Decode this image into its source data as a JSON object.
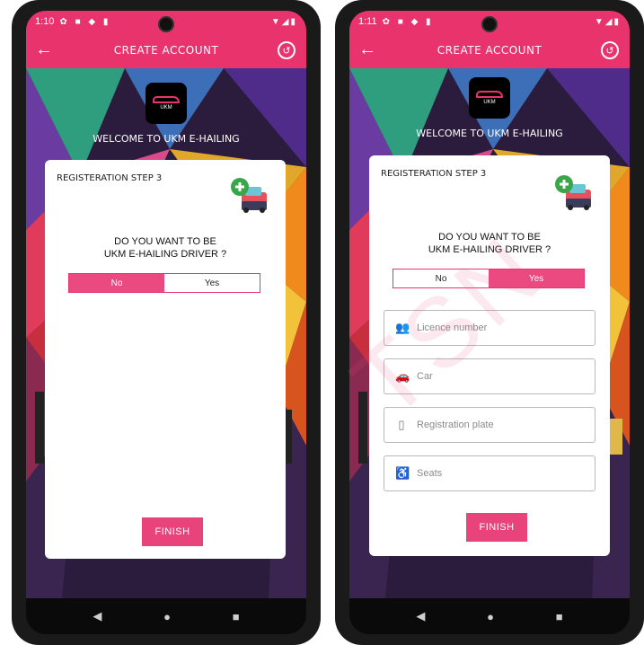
{
  "left": {
    "status_time": "1:10",
    "appbar_title": "CREATE ACCOUNT",
    "welcome": "WELCOME TO UKM E-HAILING",
    "logo_text": "UKM",
    "step_label": "REGISTERATION STEP 3",
    "question_line1": "DO YOU WANT TO BE",
    "question_line2": "UKM E-HAILING DRIVER ?",
    "toggle_no": "No",
    "toggle_yes": "Yes",
    "selected": "No",
    "finish_label": "FINISH"
  },
  "right": {
    "status_time": "1:11",
    "appbar_title": "CREATE ACCOUNT",
    "welcome": "WELCOME TO UKM E-HAILING",
    "logo_text": "UKM",
    "step_label": "REGISTERATION STEP 3",
    "question_line1": "DO YOU WANT TO BE",
    "question_line2": "UKM E-HAILING DRIVER ?",
    "toggle_no": "No",
    "toggle_yes": "Yes",
    "selected": "Yes",
    "fields": {
      "licence": "Licence number",
      "car": "Car",
      "plate": "Registration plate",
      "seats": "Seats"
    },
    "finish_label": "FINISH"
  },
  "watermark": "TSN",
  "colors": {
    "accent": "#e8336d",
    "toggle_on": "#ea4a80"
  },
  "icons": [
    "back-arrow-icon",
    "restore-icon",
    "car-add-icon",
    "person-icon",
    "car-icon",
    "phone-icon",
    "seat-icon",
    "nav-back-icon",
    "nav-home-icon",
    "nav-recents-icon"
  ]
}
